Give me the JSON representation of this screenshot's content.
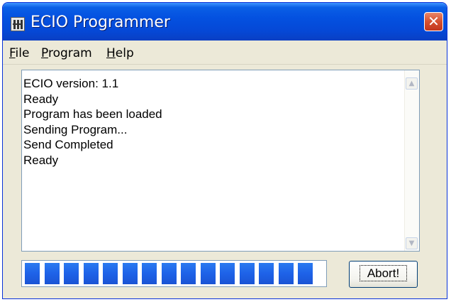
{
  "window": {
    "title": "ECIO Programmer",
    "icon": "ecio-app-icon",
    "close_label": "✕"
  },
  "menu": [
    {
      "key": "F",
      "rest": "ile"
    },
    {
      "key": "P",
      "rest": "rogram"
    },
    {
      "key": "H",
      "rest": "elp"
    }
  ],
  "log": [
    "ECIO version: 1.1",
    "Ready",
    "Program has been loaded",
    "Sending Program...",
    "Send Completed",
    "Ready"
  ],
  "progress": {
    "filled_segments": 15,
    "fraction": 0.97,
    "color": "#1e62e8"
  },
  "abort_label": "Abort!",
  "scrollbar": {
    "up_icon": "scroll-up-arrow-icon",
    "down_icon": "scroll-down-arrow-icon"
  }
}
